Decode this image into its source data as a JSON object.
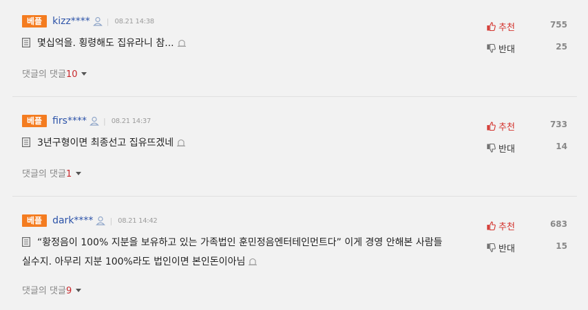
{
  "colors": {
    "badge": "#f47c20",
    "username": "#2b52a8",
    "reply_count": "#c8262a",
    "upvote": "#d3302a"
  },
  "labels": {
    "replies": "댓글의 댓글",
    "upvote": "추천",
    "downvote": "반대"
  },
  "comments": [
    {
      "badge": "베플",
      "user": "kizz****",
      "sep": "|",
      "time": "08.21 14:38",
      "lines": [
        "몇십억을. 횡령해도 집유라니 참..."
      ],
      "replies": "10",
      "up": "755",
      "down": "25"
    },
    {
      "badge": "베플",
      "user": "firs****",
      "sep": "|",
      "time": "08.21 14:37",
      "lines": [
        "3년구형이면 최종선고 집유뜨겠네"
      ],
      "replies": "1",
      "up": "733",
      "down": "14"
    },
    {
      "badge": "베플",
      "user": "dark****",
      "sep": "|",
      "time": "08.21 14:42",
      "lines": [
        "“황정음이 100% 지분을 보유하고 있는 가족법인 훈민정음엔터테인먼트다” 이게 경영 안해본 사람들",
        "실수지. 아무리 지분 100%라도 법인이면 본인돈이아님"
      ],
      "replies": "9",
      "up": "683",
      "down": "15"
    }
  ]
}
